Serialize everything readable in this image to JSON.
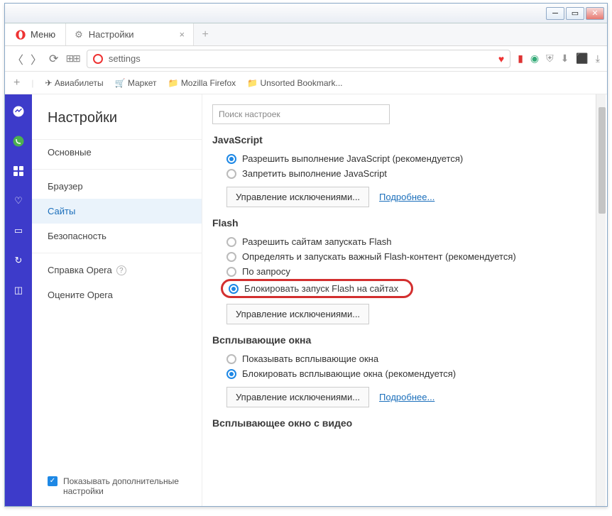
{
  "window": {
    "menu": "Меню",
    "tab_title": "Настройки",
    "url": "settings"
  },
  "bookmarks": {
    "items": [
      "Авиабилеты",
      "Маркет",
      "Mozilla Firefox",
      "Unsorted Bookmark..."
    ]
  },
  "sidebar": {
    "title": "Настройки",
    "items": [
      "Основные",
      "Браузер",
      "Сайты",
      "Безопасность"
    ],
    "help": "Справка Opera",
    "rate": "Оцените Opera",
    "show_extra": "Показывать дополнительные настройки"
  },
  "search": {
    "placeholder": "Поиск настроек"
  },
  "javascript": {
    "title": "JavaScript",
    "allow": "Разрешить выполнение JavaScript (рекомендуется)",
    "block": "Запретить выполнение JavaScript",
    "manage": "Управление исключениями...",
    "more": "Подробнее..."
  },
  "flash": {
    "title": "Flash",
    "allow": "Разрешить сайтам запускать Flash",
    "detect": "Определять и запускать важный Flash-контент (рекомендуется)",
    "ask": "По запросу",
    "block": "Блокировать запуск Flash на сайтах",
    "manage": "Управление исключениями..."
  },
  "popups": {
    "title": "Всплывающие окна",
    "show": "Показывать всплывающие окна",
    "block": "Блокировать всплывающие окна (рекомендуется)",
    "manage": "Управление исключениями...",
    "more": "Подробнее..."
  },
  "pip": {
    "title": "Всплывающее окно с видео"
  }
}
